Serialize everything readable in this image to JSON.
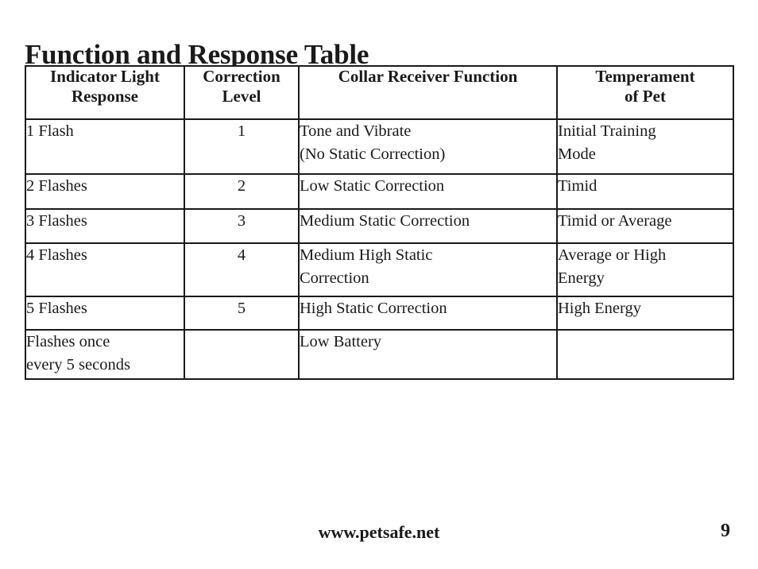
{
  "document": {
    "title": "Function and Response Table"
  },
  "table": {
    "headers": [
      "Indicator Light Response",
      "Correction Level",
      "Collar Receiver Function",
      "Temperament of Pet"
    ],
    "header_lines": {
      "col1": [
        "Indicator Light",
        "Response"
      ],
      "col2": [
        "Correction",
        "Level"
      ],
      "col3": [
        "Collar Receiver Function"
      ],
      "col4": [
        "Temperament",
        "of Pet"
      ]
    },
    "rows": [
      {
        "indicator": "1 Flash",
        "indicator_lines": [
          "1 Flash"
        ],
        "level": "1",
        "function": "Tone and Vibrate (No Static Correction)",
        "function_lines": [
          "Tone and Vibrate",
          "(No Static Correction)"
        ],
        "temperament": "Initial Training Mode",
        "temperament_lines": [
          "Initial Training",
          "Mode"
        ]
      },
      {
        "indicator": "2 Flashes",
        "indicator_lines": [
          "2 Flashes"
        ],
        "level": "2",
        "function": "Low Static Correction",
        "function_lines": [
          "Low Static Correction"
        ],
        "temperament": "Timid",
        "temperament_lines": [
          "Timid"
        ]
      },
      {
        "indicator": "3 Flashes",
        "indicator_lines": [
          "3 Flashes"
        ],
        "level": "3",
        "function": "Medium Static Correction",
        "function_lines": [
          "Medium Static Correction"
        ],
        "temperament": "Timid or Average",
        "temperament_lines": [
          "Timid or Average"
        ]
      },
      {
        "indicator": "4 Flashes",
        "indicator_lines": [
          "4 Flashes"
        ],
        "level": "4",
        "function": "Medium High Static Correction",
        "function_lines": [
          "Medium High Static",
          "Correction"
        ],
        "temperament": "Average or High Energy",
        "temperament_lines": [
          "Average or High",
          "Energy"
        ]
      },
      {
        "indicator": "5 Flashes",
        "indicator_lines": [
          "5 Flashes"
        ],
        "level": "5",
        "function": "High Static Correction",
        "function_lines": [
          "High Static Correction"
        ],
        "temperament": "High Energy",
        "temperament_lines": [
          "High Energy"
        ]
      },
      {
        "indicator": "Flashes once every 5 seconds",
        "indicator_lines": [
          "Flashes once",
          "every 5 seconds"
        ],
        "level": "",
        "function": "Low Battery",
        "function_lines": [
          "Low Battery"
        ],
        "temperament": "",
        "temperament_lines": []
      }
    ]
  },
  "footer": {
    "website": "www.petsafe.net",
    "page_number": "9"
  },
  "colors": {
    "text": "#1a1a1a",
    "background": "#ffffff",
    "border": "#1a1a1a"
  }
}
